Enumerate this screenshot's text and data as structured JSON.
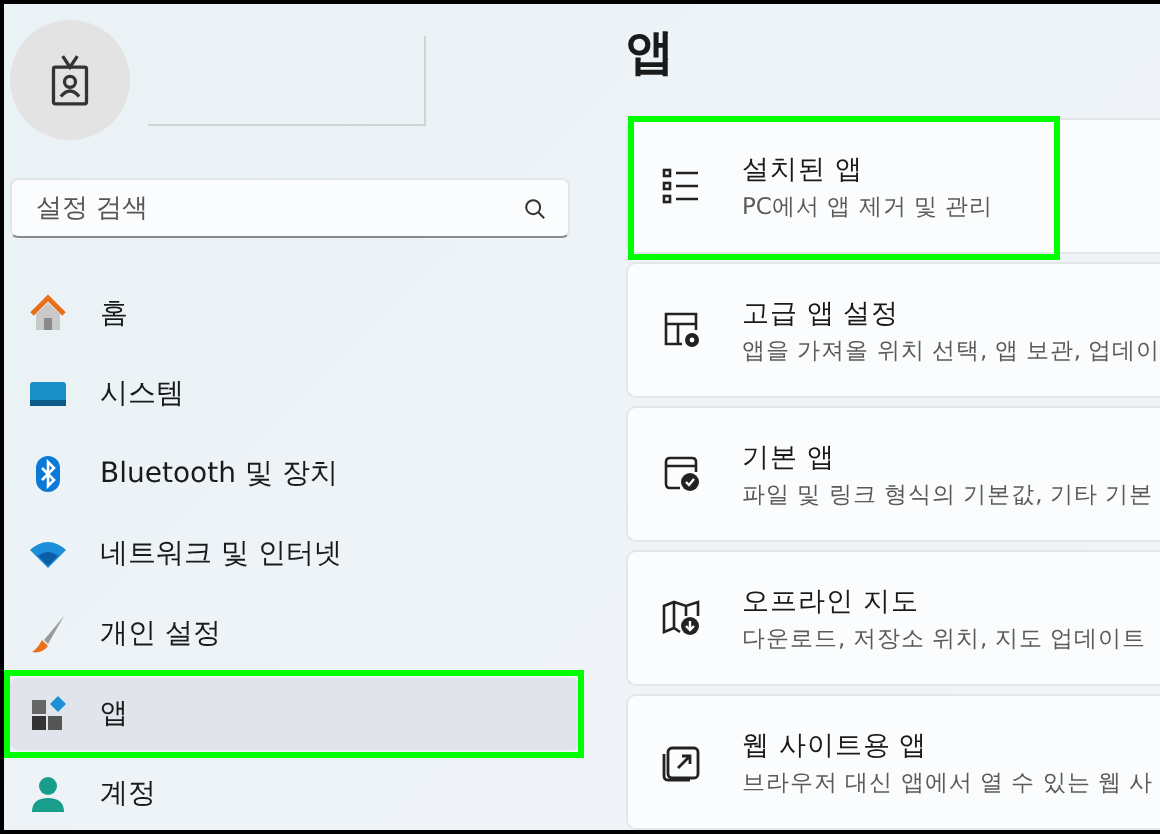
{
  "search": {
    "placeholder": "설정 검색"
  },
  "nav": [
    {
      "label": "홈",
      "kind": "home",
      "selected": false,
      "highlighted": false
    },
    {
      "label": "시스템",
      "kind": "system",
      "selected": false,
      "highlighted": false
    },
    {
      "label": "Bluetooth 및 장치",
      "kind": "bluetooth",
      "selected": false,
      "highlighted": false
    },
    {
      "label": "네트워크 및 인터넷",
      "kind": "network",
      "selected": false,
      "highlighted": false
    },
    {
      "label": "개인 설정",
      "kind": "brush",
      "selected": false,
      "highlighted": false
    },
    {
      "label": "앱",
      "kind": "apps",
      "selected": true,
      "highlighted": true
    },
    {
      "label": "계정",
      "kind": "account",
      "selected": false,
      "highlighted": false
    }
  ],
  "page": {
    "title": "앱"
  },
  "cards": [
    {
      "title": "설치된 앱",
      "subtitle": "PC에서 앱 제거 및 관리",
      "kind": "list",
      "highlighted": true
    },
    {
      "title": "고급 앱 설정",
      "subtitle": "앱을 가져올 위치 선택, 앱 보관, 업데이",
      "kind": "advanced",
      "highlighted": false
    },
    {
      "title": "기본 앱",
      "subtitle": "파일 및 링크 형식의 기본값, 기타 기본",
      "kind": "defaults",
      "highlighted": false
    },
    {
      "title": "오프라인 지도",
      "subtitle": "다운로드, 저장소 위치, 지도 업데이트",
      "kind": "map",
      "highlighted": false
    },
    {
      "title": "웹 사이트용 앱",
      "subtitle": "브라우저 대신 앱에서 열 수 있는 웹 사",
      "kind": "web",
      "highlighted": false
    }
  ]
}
